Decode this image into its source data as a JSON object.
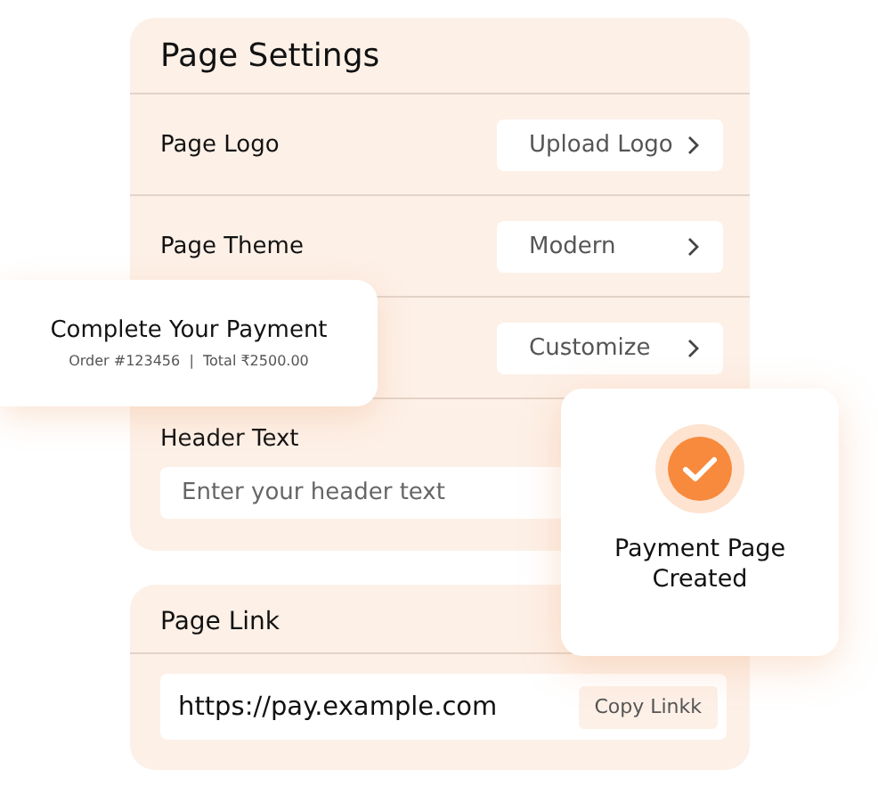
{
  "settings": {
    "title": "Page Settings",
    "rows": [
      {
        "label": "Page Logo",
        "action": "Upload Logo"
      },
      {
        "label": "Page Theme",
        "action": "Modern"
      },
      {
        "action": "Customize"
      }
    ],
    "header_field": {
      "label": "Header Text",
      "placeholder": "Enter your header text"
    }
  },
  "page_link": {
    "title": "Page Link",
    "url": "https://pay.example.com",
    "button": "Copy Linkk"
  },
  "payment_card": {
    "title": "Complete Your Payment",
    "subtitle": "Order #123456  |  Total ₹2500.00"
  },
  "toast": {
    "message": "Payment Page Created"
  }
}
